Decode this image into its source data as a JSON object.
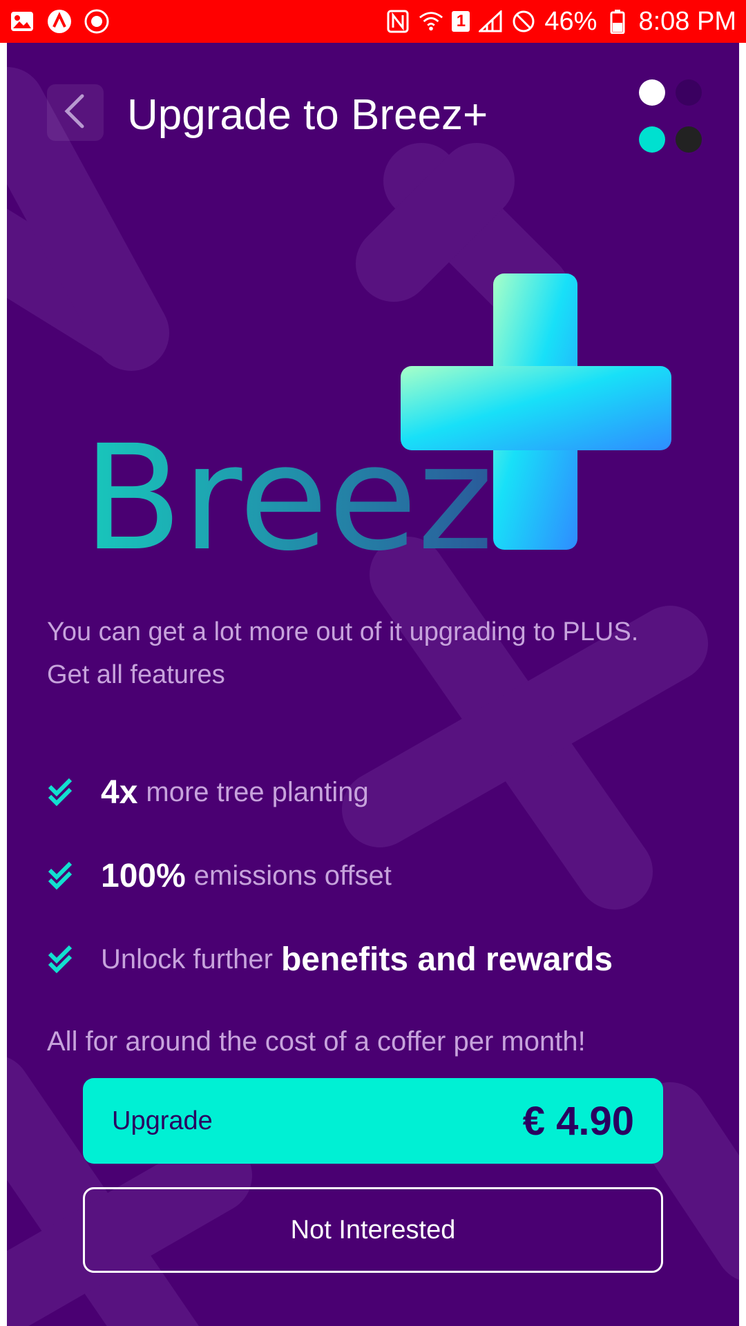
{
  "status_bar": {
    "left_icons": [
      "image-icon",
      "app-a-icon",
      "badge-icon"
    ],
    "right_icons": [
      "nfc-icon",
      "wifi-icon",
      "sim-1-icon",
      "signal-icon",
      "no-disturb-icon",
      "battery-icon"
    ],
    "wifi_sim_label": "1",
    "battery": "46%",
    "time": "8:08 PM"
  },
  "header": {
    "title": "Upgrade to Breez+",
    "back_icon": "chevron-left-icon"
  },
  "dots": {
    "colors": [
      "#ffffff",
      "#3a0060",
      "#00e0d0",
      "#222222"
    ]
  },
  "logo": {
    "wordmark": "Breez",
    "plus_icon": "plus-icon"
  },
  "intro": "You can get a lot more out of it upgrading to PLUS. Get all features",
  "features": [
    {
      "strong": "4x",
      "soft": "more tree planting"
    },
    {
      "strong": "100%",
      "soft": "emissions offset"
    },
    {
      "soft": "Unlock further",
      "strong": "benefits and rewards"
    }
  ],
  "closing": "All for around the cost of a coffer per month!",
  "upgrade": {
    "label": "Upgrade",
    "price": "€ 4.90"
  },
  "not_interested": "Not Interested",
  "colors": {
    "background": "#4a0072",
    "accent": "#00f0d4",
    "muted_text": "#c7a3dc",
    "status_bar": "#ff0000"
  }
}
